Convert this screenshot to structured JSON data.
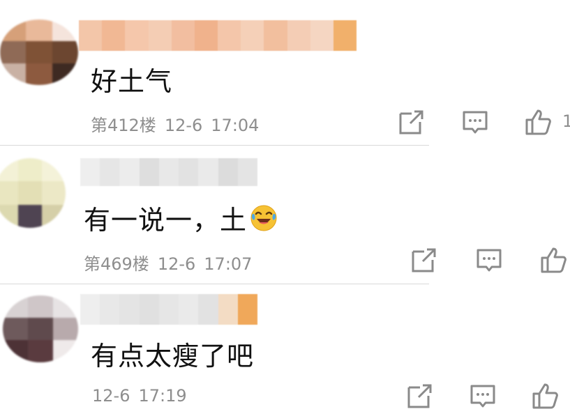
{
  "comments": [
    {
      "text": "好土气",
      "floor": "第412楼",
      "date": "12-6",
      "time": "17:04",
      "like_count": "1",
      "avatar_colors": [
        "#d6a079",
        "#e9b99a",
        "#f5e4dc",
        "#8f6a56",
        "#7f5236",
        "#6c4630",
        "#c9b1a4",
        "#8d5a3f",
        "#3e2a22"
      ],
      "name_colors": [
        "#f3c6a9",
        "#f1b894",
        "#f5c7ab",
        "#f4cdb4",
        "#f2bea0",
        "#f0b28c",
        "#f4c6aa",
        "#f5d0b8",
        "#f2bf9e",
        "#f4cdb5",
        "#f5d6c2",
        "#f1b06b"
      ]
    },
    {
      "text": "有一说一，土",
      "floor": "第469楼",
      "date": "12-6",
      "time": "17:07",
      "like_count": "",
      "avatar_colors": [
        "#f3f1d6",
        "#eeedc9",
        "#f4f2d9",
        "#e9e6c0",
        "#e3dfb5",
        "#ece8c6",
        "#dcd9b0",
        "#4f4452",
        "#d5cfa8"
      ],
      "name_colors": [
        "#eeeeee",
        "#e6e6e6",
        "#ececec",
        "#dedede",
        "#e8e8e8",
        "#e2e2e2",
        "#eaeaea",
        "#dcdcdc",
        "#e4e4e4"
      ]
    },
    {
      "text": "有点太瘦了吧",
      "floor": "",
      "date": "12-6",
      "time": "17:19",
      "like_count": "",
      "avatar_colors": [
        "#d8d2d3",
        "#cfc6c8",
        "#e7e3e4",
        "#6e5a5c",
        "#5f4a4d",
        "#b8aaac",
        "#4d3236",
        "#5a3b3f",
        "#efeaea"
      ],
      "name_colors": [
        "#eeeeee",
        "#e8e8e8",
        "#e4e4e4",
        "#e0e0e0",
        "#e6e6e6",
        "#eaeaea",
        "#e2e2e2",
        "#f3dcc4",
        "#f0a85a"
      ]
    }
  ],
  "icons": {
    "share": "share-icon",
    "comment": "comment-icon",
    "like": "like-icon",
    "emoji": "laughing-crying-emoji"
  },
  "colors": {
    "meta_text": "#8e8e8e",
    "body_text": "#111111",
    "divider": "#d9d9d9"
  }
}
